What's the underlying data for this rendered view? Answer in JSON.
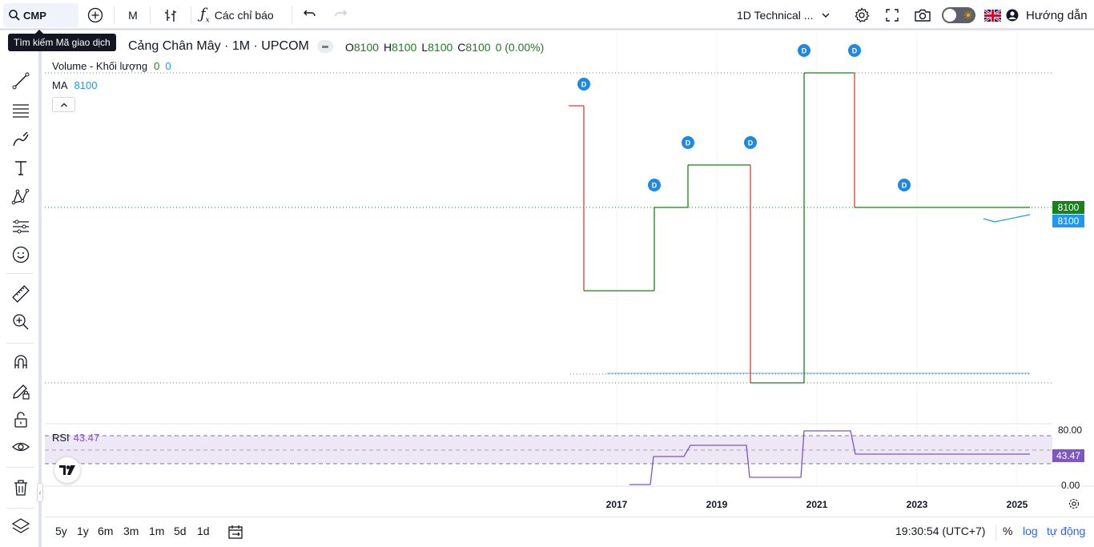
{
  "topbar": {
    "symbol": "CMP",
    "interval": "M",
    "indicators_label": "Các chỉ báo",
    "layout_label": "1D Technical ...",
    "guide_label": "Hướng dẫn"
  },
  "tooltip": "Tìm kiếm Mã giao dịch",
  "legend": {
    "symbol_name": "Cảng Chân Mây · 1M · UPCOM",
    "o_label": "O",
    "o_value": "8100",
    "h_label": "H",
    "h_value": "8100",
    "l_label": "L",
    "l_value": "8100",
    "c_label": "C",
    "c_value": "8100",
    "change": "0 (0.00%)",
    "volume_label": "Volume - Khối lượng",
    "volume_value_1": "0",
    "volume_value_2": "0",
    "ma_label": "MA",
    "ma_value": "8100",
    "rsi_label": "RSI",
    "rsi_value": "43.47"
  },
  "price_scale": {
    "last_price": "8100",
    "ma_price": "8100",
    "rsi_top": "80.00",
    "rsi_value": "43.47",
    "rsi_bottom": "0.00"
  },
  "time_axis": [
    "2017",
    "2019",
    "2021",
    "2023",
    "2025"
  ],
  "dividend_marker": "D",
  "bottombar": {
    "ranges": [
      "5y",
      "1y",
      "6m",
      "3m",
      "1m",
      "5d",
      "1d"
    ],
    "clock": "19:30:54 (UTC+7)",
    "percent": "%",
    "log": "log",
    "auto": "tự động"
  },
  "colors": {
    "up": "#1b7f1b",
    "down": "#e53935",
    "ma": "#2196f3",
    "rsi": "#7e57c2",
    "rsi_band": "#ede7f6",
    "marker": "#1e88e5"
  }
}
